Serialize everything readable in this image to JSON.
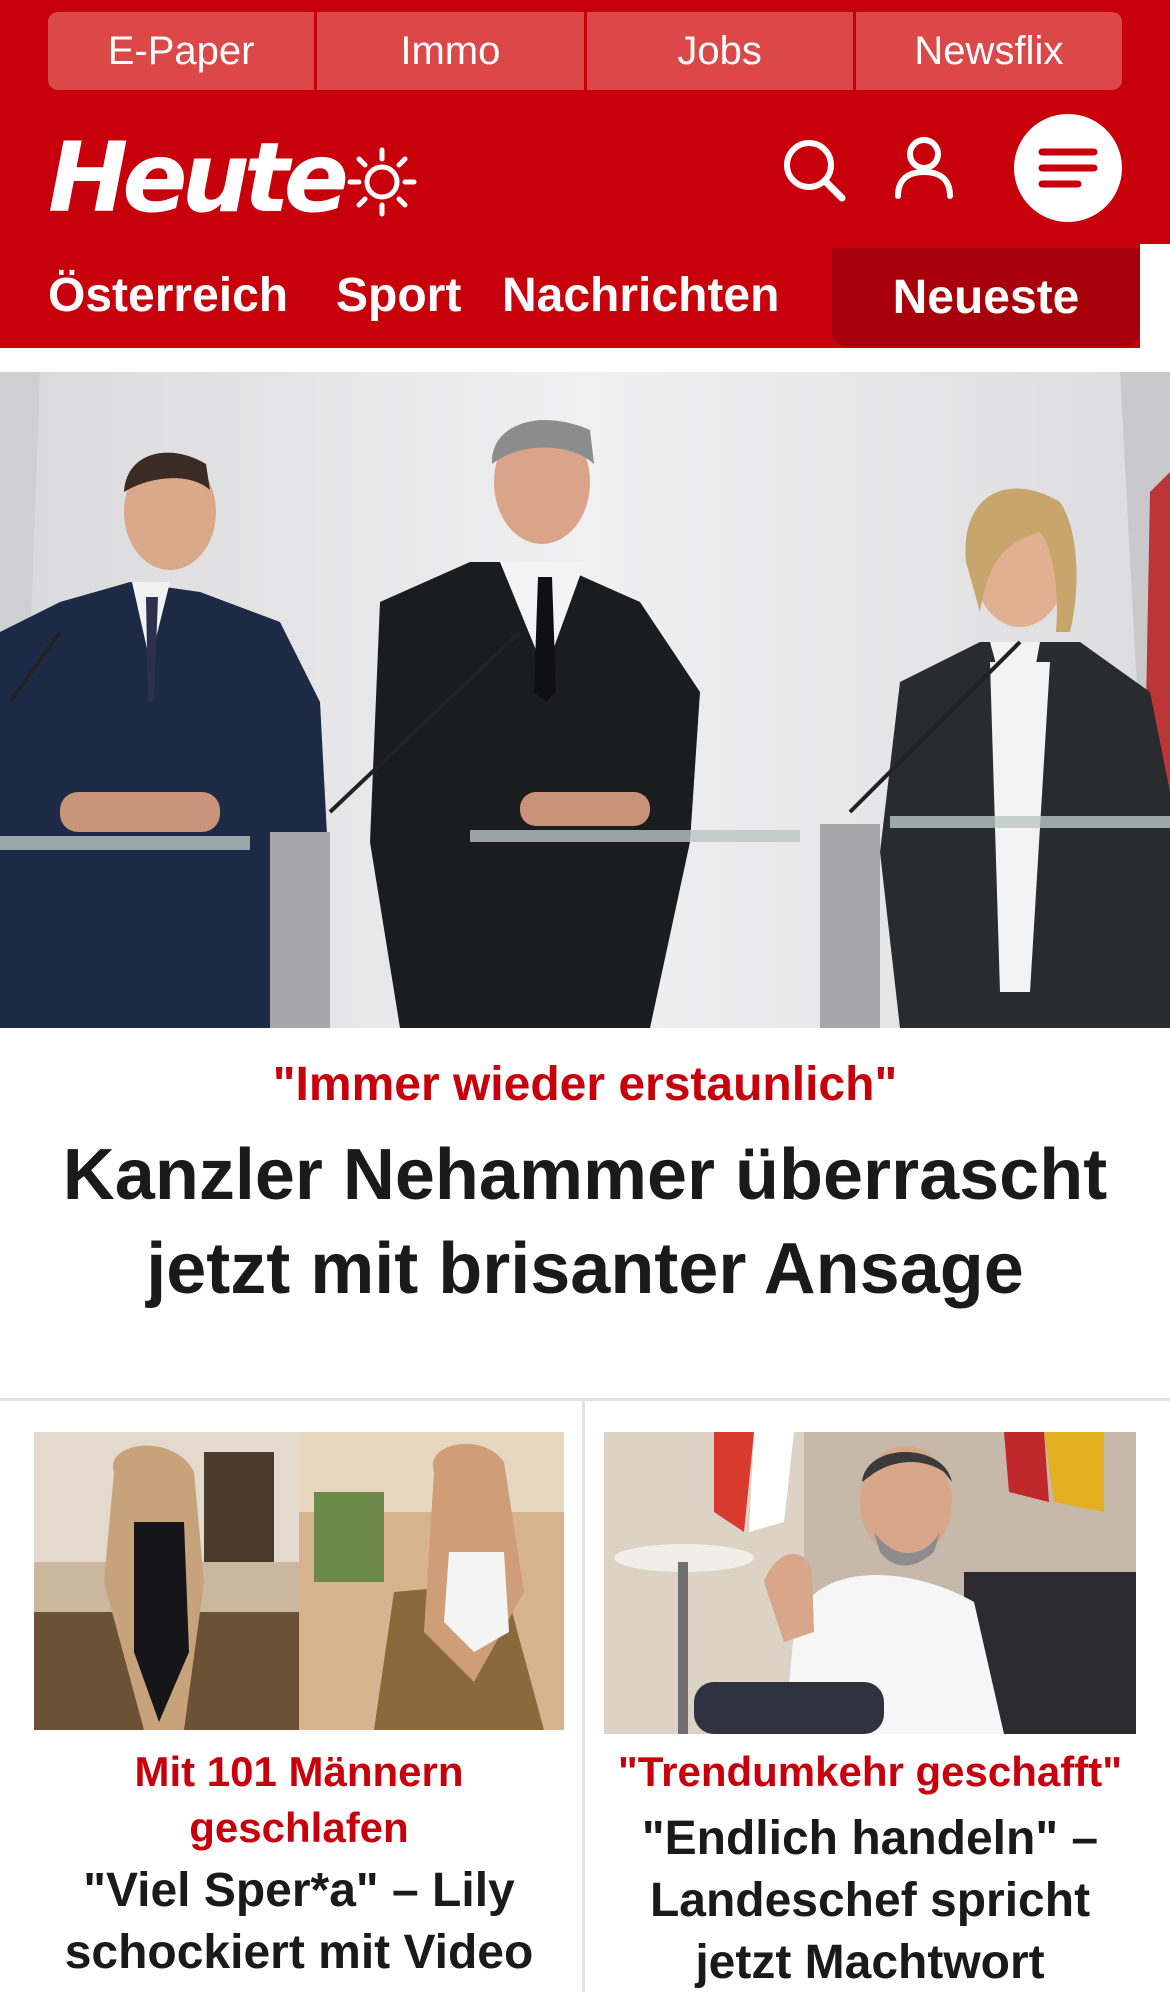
{
  "service_links": [
    "E-Paper",
    "Immo",
    "Jobs",
    "Newsflix"
  ],
  "brand": {
    "logo_text": "Heute",
    "color": "#c8000c"
  },
  "icons": {
    "theme": "sun-icon",
    "search": "search-icon",
    "account": "user-icon",
    "menu": "hamburger-menu-icon"
  },
  "nav": {
    "items": [
      "Österreich",
      "Sport",
      "Nachrichten"
    ],
    "active": "Neueste"
  },
  "hero": {
    "kicker": "\"Immer wieder erstaunlich\"",
    "title": "Kanzler Nehammer überrascht jetzt mit brisanter Ansage"
  },
  "cards": [
    {
      "kicker": "Mit 101 Männern geschlafen",
      "title": "\"Viel Sper*a\" – Lily schockiert mit Video"
    },
    {
      "kicker": "\"Trendumkehr geschafft\"",
      "title": "\"Endlich handeln\" – Landeschef spricht jetzt Machtwort"
    }
  ]
}
